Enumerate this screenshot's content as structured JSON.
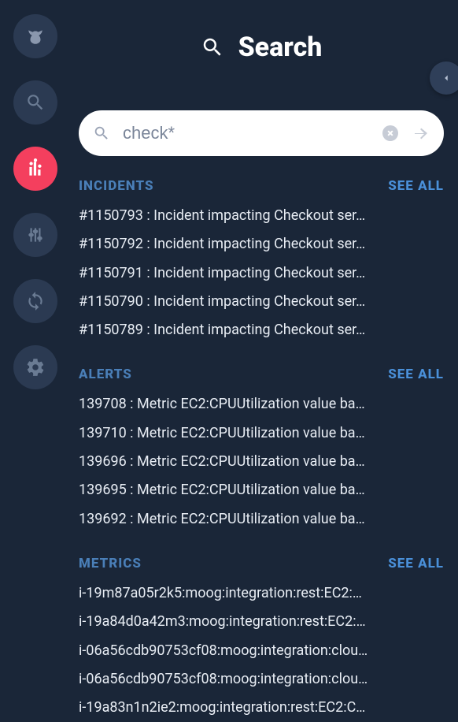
{
  "header": {
    "title": "Search"
  },
  "search": {
    "value": "check*",
    "placeholder": ""
  },
  "labels": {
    "see_all": "SEE ALL"
  },
  "sections": {
    "incidents": {
      "title": "INCIDENTS",
      "items": [
        "#1150793 : Incident impacting Checkout ser…",
        "#1150792 : Incident impacting Checkout ser…",
        "#1150791 : Incident impacting Checkout ser…",
        "#1150790 : Incident impacting Checkout ser…",
        "#1150789 : Incident impacting Checkout ser…"
      ]
    },
    "alerts": {
      "title": "ALERTS",
      "items": [
        "139708 : Metric EC2:CPUUtilization value ba…",
        "139710 : Metric EC2:CPUUtilization value ba…",
        "139696 : Metric EC2:CPUUtilization value ba…",
        "139695 : Metric EC2:CPUUtilization value ba…",
        "139692 : Metric EC2:CPUUtilization value ba…"
      ]
    },
    "metrics": {
      "title": "METRICS",
      "items": [
        "i-19m87a05r2k5:moog:integration:rest:EC2:…",
        "i-19a84d0a42m3:moog:integration:rest:EC2:…",
        "i-06a56cdb90753cf08:moog:integration:clou…",
        "i-06a56cdb90753cf08:moog:integration:clou…",
        "i-19a83n1n2ie2:moog:integration:rest:EC2:C…"
      ]
    }
  },
  "nav": {
    "items": [
      "logo",
      "search",
      "dashboard",
      "tuning",
      "sync",
      "settings"
    ],
    "active_index": 2
  }
}
